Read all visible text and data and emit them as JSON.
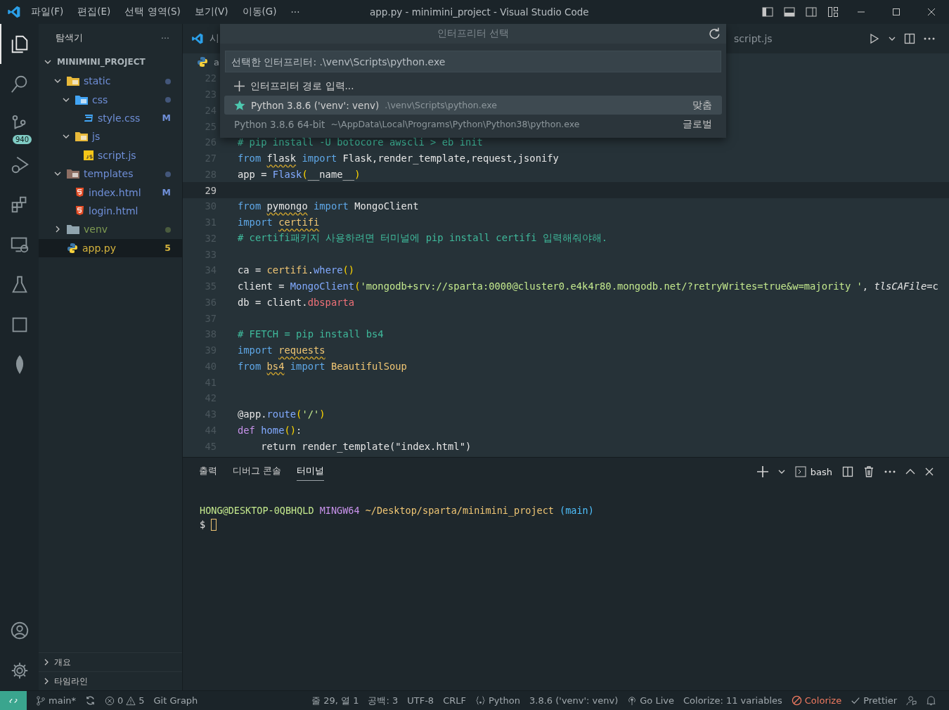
{
  "window": {
    "title": "app.py - minimini_project - Visual Studio Code"
  },
  "menu": [
    "파일(F)",
    "편집(E)",
    "선택 영역(S)",
    "보기(V)",
    "이동(G)",
    "···"
  ],
  "activity_bar": [
    {
      "selected": true
    },
    {
      "selected": false
    },
    {
      "selected": false,
      "badge": "940"
    },
    {
      "selected": false
    },
    {
      "selected": false
    },
    {
      "selected": false
    },
    {
      "selected": false
    },
    {
      "selected": false
    },
    {
      "selected": false
    }
  ],
  "sidebar": {
    "title": "탐색기",
    "more": "···",
    "project": {
      "label": "MINIMINI_PROJECT",
      "expanded": true
    },
    "tree": [
      {
        "label": "static",
        "kind": "assetfolder",
        "expanded": true,
        "selected": false,
        "color": "#6f8fd8",
        "dot": true,
        "children": [
          {
            "label": "css",
            "kind": "cssfolder",
            "expanded": true,
            "selected": false,
            "color": "#6f8fd8",
            "dot": true,
            "children": [
              {
                "label": "style.css",
                "kind": "css",
                "selected": false,
                "color": "#6f8fd8",
                "dot": false,
                "decoration": "M"
              }
            ]
          },
          {
            "label": "js",
            "kind": "jsfolder",
            "expanded": true,
            "selected": false,
            "color": "#6f8fd8",
            "dot": false,
            "children": [
              {
                "label": "script.js",
                "kind": "js",
                "selected": false,
                "color": "#6f8fd8",
                "dot": false
              }
            ]
          }
        ]
      },
      {
        "label": "templates",
        "kind": "templatefolder",
        "expanded": true,
        "selected": false,
        "color": "#6f8fd8",
        "dot": true,
        "children": [
          {
            "label": "index.html",
            "kind": "html",
            "selected": false,
            "color": "#6f8fd8",
            "dot": false,
            "decoration": "M"
          },
          {
            "label": "login.html",
            "kind": "html",
            "selected": false,
            "color": "#6f8fd8",
            "dot": false
          }
        ]
      },
      {
        "label": "venv",
        "kind": "folder",
        "expanded": false,
        "selected": false,
        "color": "#7e9a52",
        "dot": true
      },
      {
        "label": "app.py",
        "kind": "python",
        "selected": true,
        "color": "#d7b53d",
        "dot": false,
        "decoration": "5"
      }
    ],
    "sections": [
      {
        "label": "개요",
        "expanded": false
      },
      {
        "label": "타임라인",
        "expanded": false
      }
    ]
  },
  "editor": {
    "tabs": [
      {
        "label": "시",
        "kind": "welcome"
      },
      {
        "label": "script.js",
        "kind": "file"
      }
    ],
    "breadcrumb": "a",
    "lines": [
      {
        "number": "22",
        "current": false
      },
      {
        "number": "23",
        "current": false
      },
      {
        "number": "24",
        "current": false
      },
      {
        "number": "25",
        "current": false
      },
      {
        "number": "26",
        "current": false,
        "tokens": [
          {
            "text": "# pip install -U botocore awscli > eb init",
            "kind": "comment"
          }
        ]
      },
      {
        "number": "27",
        "current": false,
        "tokens": [
          {
            "text": "from ",
            "kind": "keyword"
          },
          {
            "text": "flask",
            "kind": "plain",
            "squiggle": true
          },
          {
            "text": " import",
            "kind": "keyword"
          },
          {
            "text": " Flask,render_template,request,jsonify",
            "kind": "plain"
          }
        ]
      },
      {
        "number": "28",
        "current": false,
        "tokens": [
          {
            "text": "app = ",
            "kind": "plain"
          },
          {
            "text": "Flask",
            "kind": "class"
          },
          {
            "text": "(",
            "kind": "paren"
          },
          {
            "text": "__name__",
            "kind": "plain"
          },
          {
            "text": ")",
            "kind": "paren"
          }
        ]
      },
      {
        "number": "29",
        "current": true
      },
      {
        "number": "30",
        "current": false,
        "tokens": [
          {
            "text": "from ",
            "kind": "keyword"
          },
          {
            "text": "pymongo",
            "kind": "plain",
            "squiggle": true
          },
          {
            "text": " import",
            "kind": "keyword"
          },
          {
            "text": " MongoClient",
            "kind": "plain"
          }
        ]
      },
      {
        "number": "31",
        "current": false,
        "tokens": [
          {
            "text": "import ",
            "kind": "keyword"
          },
          {
            "text": "certifi",
            "kind": "module",
            "squiggle": true
          }
        ]
      },
      {
        "number": "32",
        "current": false,
        "tokens": [
          {
            "text": "# certifi패키지 사용하려면 터미널에 pip install certifi 입력해줘야해.",
            "kind": "comment"
          }
        ]
      },
      {
        "number": "33",
        "current": false
      },
      {
        "number": "34",
        "current": false,
        "tokens": [
          {
            "text": "ca = ",
            "kind": "plain"
          },
          {
            "text": "certifi",
            "kind": "module"
          },
          {
            "text": ".",
            "kind": "plain"
          },
          {
            "text": "where",
            "kind": "function"
          },
          {
            "text": "()",
            "kind": "paren"
          }
        ]
      },
      {
        "number": "35",
        "current": false,
        "tokens": [
          {
            "text": "client = ",
            "kind": "plain"
          },
          {
            "text": "MongoClient",
            "kind": "class"
          },
          {
            "text": "(",
            "kind": "paren"
          },
          {
            "text": "'mongodb+srv://sparta:0000@cluster0.e4k4r80.mongodb.net/?retryWrites=true&w=majority '",
            "kind": "string"
          },
          {
            "text": ", ",
            "kind": "plain"
          },
          {
            "text": "tlsCAFile",
            "kind": "param"
          },
          {
            "text": "=c",
            "kind": "plain"
          }
        ]
      },
      {
        "number": "36",
        "current": false,
        "tokens": [
          {
            "text": "db = client.",
            "kind": "plain"
          },
          {
            "text": "dbsparta",
            "kind": "property"
          }
        ]
      },
      {
        "number": "37",
        "current": false
      },
      {
        "number": "38",
        "current": false,
        "tokens": [
          {
            "text": "# FETCH = pip install bs4",
            "kind": "comment"
          }
        ]
      },
      {
        "number": "39",
        "current": false,
        "tokens": [
          {
            "text": "import ",
            "kind": "keyword"
          },
          {
            "text": "requests",
            "kind": "module",
            "squiggle": true
          }
        ]
      },
      {
        "number": "40",
        "current": false,
        "tokens": [
          {
            "text": "from ",
            "kind": "keyword"
          },
          {
            "text": "bs4",
            "kind": "module",
            "squiggle": true
          },
          {
            "text": " import ",
            "kind": "keyword"
          },
          {
            "text": "BeautifulSoup",
            "kind": "module"
          }
        ]
      },
      {
        "number": "41",
        "current": false
      },
      {
        "number": "42",
        "current": false
      },
      {
        "number": "43",
        "current": false,
        "tokens": [
          {
            "text": "@app",
            "kind": "plain"
          },
          {
            "text": ".",
            "kind": "plain"
          },
          {
            "text": "route",
            "kind": "function"
          },
          {
            "text": "(",
            "kind": "paren"
          },
          {
            "text": "'/'",
            "kind": "string"
          },
          {
            "text": ")",
            "kind": "paren"
          }
        ]
      },
      {
        "number": "44",
        "current": false,
        "tokens": [
          {
            "text": "def ",
            "kind": "def"
          },
          {
            "text": "home",
            "kind": "function"
          },
          {
            "text": "()",
            "kind": "paren"
          },
          {
            "text": ":",
            "kind": "plain"
          }
        ]
      },
      {
        "number": "45",
        "current": false,
        "tokens": [
          {
            "text": "    return render_template(\"index.html\")",
            "kind": "plain"
          }
        ]
      }
    ]
  },
  "quick_pick": {
    "title": "인터프리터 선택",
    "placeholder": "선택한 인터프리터: .\\venv\\Scripts\\python.exe",
    "items": [
      {
        "kind": "action",
        "label": "인터프리터 경로 입력...",
        "selected": false
      },
      {
        "kind": "interpreter",
        "label": "Python 3.8.6 ('venv': venv)",
        "description": ".\\venv\\Scripts\\python.exe",
        "detail": "맞춤",
        "selected": true,
        "starred": true
      },
      {
        "kind": "interpreter",
        "label": "Python 3.8.6 64-bit",
        "description": "~\\AppData\\Local\\Programs\\Python\\Python38\\python.exe",
        "detail": "글로벌",
        "selected": false,
        "starred": false
      }
    ]
  },
  "panel": {
    "tabs": [
      {
        "label": "출력",
        "selected": false
      },
      {
        "label": "디버그 콘솔",
        "selected": false
      },
      {
        "label": "터미널",
        "selected": true
      }
    ],
    "shell": "bash",
    "terminal": [
      [
        {
          "text": "HONG@DESKTOP-0QBHQLD",
          "kind": "user"
        },
        {
          "text": " MINGW64",
          "kind": "system"
        },
        {
          "text": " ~/Desktop/sparta/minimini_project",
          "kind": "path"
        },
        {
          "text": " (main)",
          "kind": "branch"
        }
      ],
      [
        {
          "text": "$ ",
          "kind": "plain"
        }
      ]
    ]
  },
  "status_bar": {
    "branch": "main*",
    "errors": "0",
    "warnings": "5",
    "git_graph": "Git Graph",
    "items": [
      {
        "kind": "text",
        "text": "줄 29, 열 1"
      },
      {
        "kind": "text",
        "text": "공백: 3"
      },
      {
        "kind": "text",
        "text": "UTF-8"
      },
      {
        "kind": "text",
        "text": "CRLF"
      },
      {
        "kind": "language",
        "text": "Python"
      },
      {
        "kind": "text",
        "text": "3.8.6 ('venv': venv)"
      },
      {
        "kind": "golive",
        "text": "Go Live"
      },
      {
        "kind": "text",
        "text": "Colorize: 11 variables"
      },
      {
        "kind": "colorize",
        "text": "Colorize"
      },
      {
        "kind": "check",
        "text": "Prettier"
      }
    ]
  }
}
